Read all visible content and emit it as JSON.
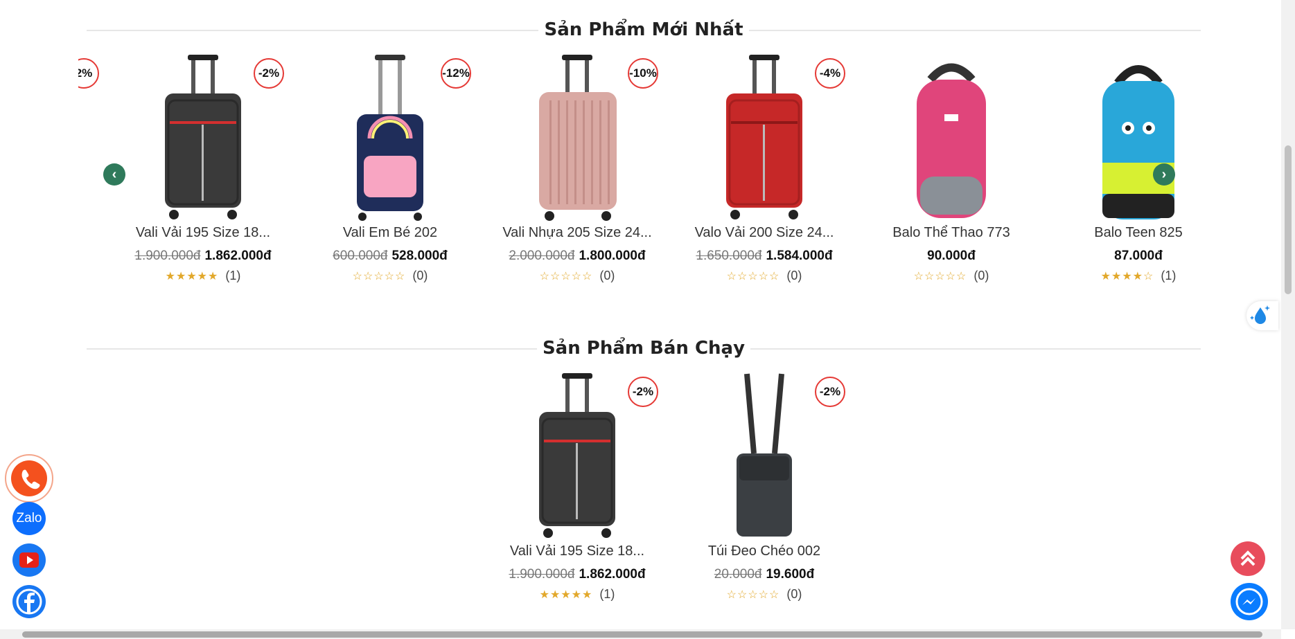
{
  "section_new": {
    "title": "Sản Phẩm Mới Nhất",
    "products": [
      {
        "name": "Vali Vải 195 Size 18...",
        "badge": "-2%",
        "old_price": "1.900.000đ",
        "price": "1.862.000đ",
        "rating": 5,
        "reviews": "(1)",
        "image": "black-soft-suitcase"
      },
      {
        "name": "Vali Em Bé 202",
        "badge": "-12%",
        "old_price": "600.000đ",
        "price": "528.000đ",
        "rating": 0,
        "reviews": "(0)",
        "image": "kids-unicorn-suitcase"
      },
      {
        "name": "Vali Nhựa 205 Size 24...",
        "badge": "-10%",
        "old_price": "2.000.000đ",
        "price": "1.800.000đ",
        "rating": 0,
        "reviews": "(0)",
        "image": "rose-gold-hard-suitcase"
      },
      {
        "name": "Valo Vải 200 Size 24...",
        "badge": "-4%",
        "old_price": "1.650.000đ",
        "price": "1.584.000đ",
        "rating": 0,
        "reviews": "(0)",
        "image": "red-soft-suitcase"
      },
      {
        "name": "Balo Thể Thao 773",
        "badge": "",
        "old_price": "",
        "price": "90.000đ",
        "rating": 0,
        "reviews": "(0)",
        "image": "pink-backpack"
      },
      {
        "name": "Balo Teen 825",
        "badge": "",
        "old_price": "",
        "price": "87.000đ",
        "rating": 4,
        "reviews": "(1)",
        "image": "blue-lime-backpack"
      }
    ],
    "partial_badge": "2%"
  },
  "section_best": {
    "title": "Sản Phẩm Bán Chạy",
    "products": [
      {
        "name": "Vali Vải 195 Size 18...",
        "badge": "-2%",
        "old_price": "1.900.000đ",
        "price": "1.862.000đ",
        "rating": 5,
        "reviews": "(1)",
        "image": "black-soft-suitcase"
      },
      {
        "name": "Túi Đeo Chéo 002",
        "badge": "-2%",
        "old_price": "20.000đ",
        "price": "19.600đ",
        "rating": 0,
        "reviews": "(0)",
        "image": "crossbody-bag"
      }
    ]
  },
  "floating": {
    "zalo_label": "Zalo",
    "colors": {
      "phone": "#f4511e",
      "zalo": "#0d6efd",
      "youtube": "#e62117",
      "facebook": "#1877f2",
      "top": "#e84c5c",
      "messenger": "#0a7cff",
      "nav": "#2f7a5b",
      "badge": "#e53935",
      "stars": "#e2a82b"
    }
  }
}
